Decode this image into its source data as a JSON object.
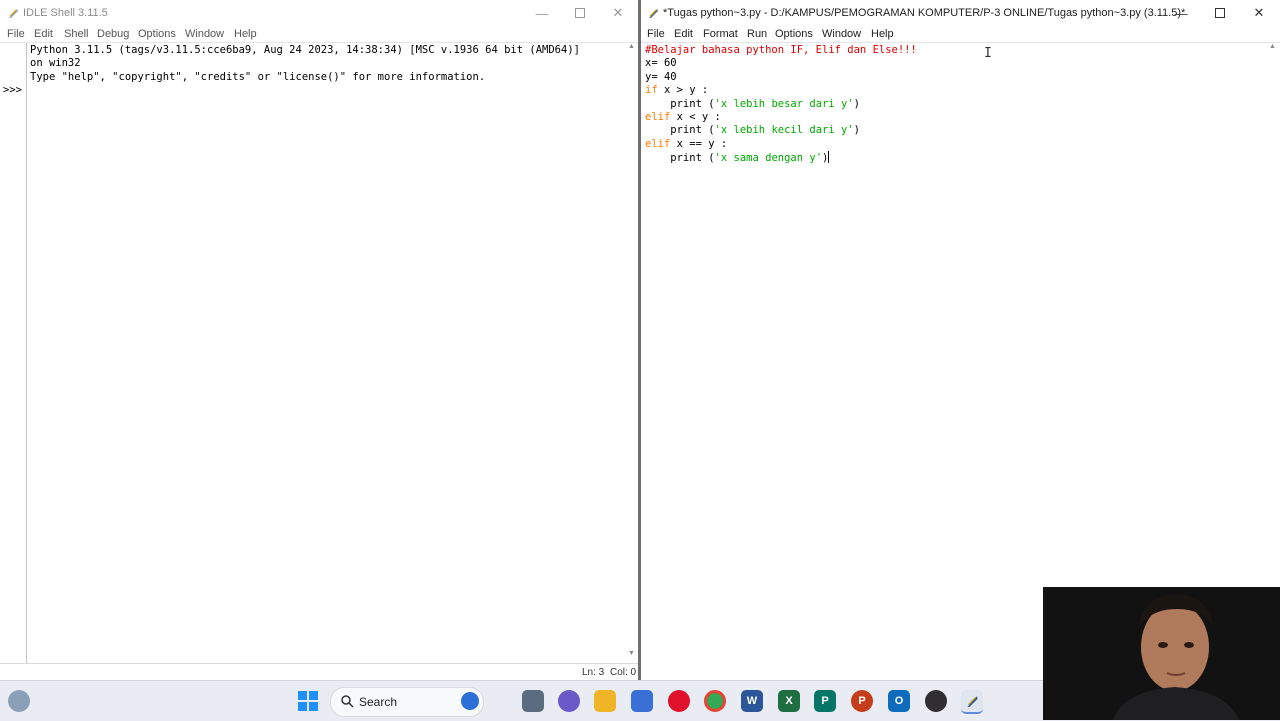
{
  "shell": {
    "title": "IDLE Shell 3.11.5",
    "menu": [
      "File",
      "Edit",
      "Shell",
      "Debug",
      "Options",
      "Window",
      "Help"
    ],
    "banner": "Python 3.11.5 (tags/v3.11.5:cce6ba9, Aug 24 2023, 14:38:34) [MSC v.1936 64 bit (AMD64)]\non win32\nType \"help\", \"copyright\", \"credits\" or \"license()\" for more information.",
    "prompt": ">>>",
    "status": {
      "ln": "Ln: 3",
      "col": "Col: 0"
    }
  },
  "editor": {
    "title": "*Tugas python~3.py - D:/KAMPUS/PEMOGRAMAN KOMPUTER/P-3 ONLINE/Tugas python~3.py (3.11.5)*",
    "menu": [
      "File",
      "Edit",
      "Format",
      "Run",
      "Options",
      "Window",
      "Help"
    ],
    "code": {
      "comment": "#Belajar bahasa python IF, Elif dan Else!!!",
      "line_x": "x= 60",
      "line_y": "y= 40",
      "if_kw": "if",
      "if_cond": " x > y :",
      "print1_pre": "    print (",
      "print1_str": "'x lebih besar dari y'",
      "print1_post": ")",
      "elif1_kw": "elif",
      "elif1_cond": " x < y :",
      "print2_pre": "    print (",
      "print2_str": "'x lebih kecil dari y'",
      "print2_post": ")",
      "elif2_kw": "elif",
      "elif2_cond": " x == y :",
      "print3_pre": "    print (",
      "print3_str": "'x sama dengan y'",
      "print3_post": ")"
    }
  },
  "taskbar": {
    "search_label": "Search",
    "apps": [
      "windows-start-icon",
      "file-explorer-icon",
      "microsoft-store-icon",
      "opera-icon",
      "chrome-icon",
      "word-icon",
      "excel-icon",
      "publisher-icon",
      "powerpoint-icon",
      "outlook-icon",
      "obs-icon",
      "idle-python-icon"
    ]
  },
  "colors": {
    "keyword": "#ff7700",
    "string": "#00aa00",
    "comment": "#dd0000",
    "taskbar_bg": "#e9edf3"
  }
}
